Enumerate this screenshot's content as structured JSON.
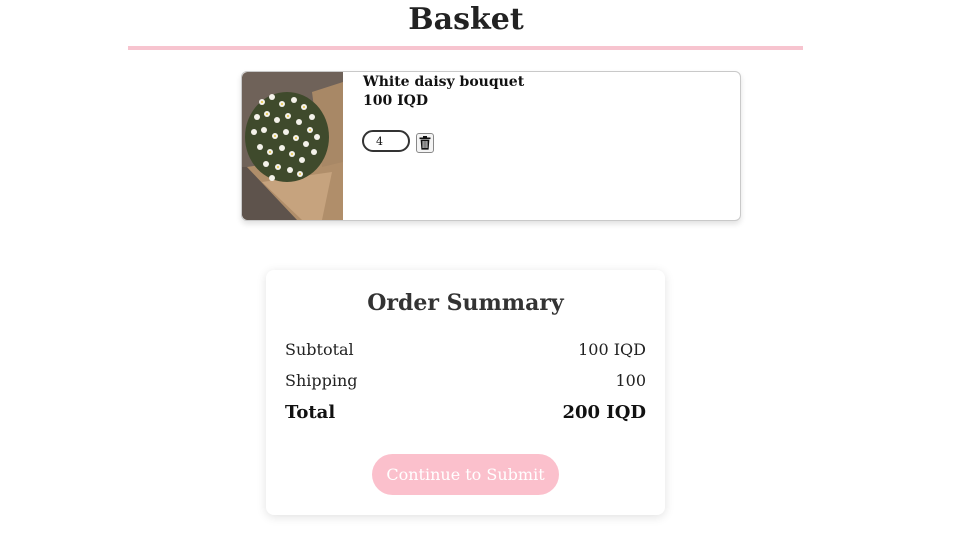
{
  "page": {
    "title": "Basket"
  },
  "cart": {
    "items": [
      {
        "name": "White daisy bouquet",
        "price": "100 IQD",
        "quantity": "4",
        "image_icon": "daisy-bouquet-photo",
        "delete_icon": "trash-icon"
      }
    ]
  },
  "summary": {
    "title": "Order Summary",
    "subtotal_label": "Subtotal",
    "subtotal_value": "100 IQD",
    "shipping_label": "Shipping",
    "shipping_value": "100",
    "total_label": "Total",
    "total_value": "200 IQD",
    "submit_label": "Continue to Submit"
  },
  "colors": {
    "accent_pink": "#f7c4cf",
    "button_pink": "#fbc0cc"
  }
}
